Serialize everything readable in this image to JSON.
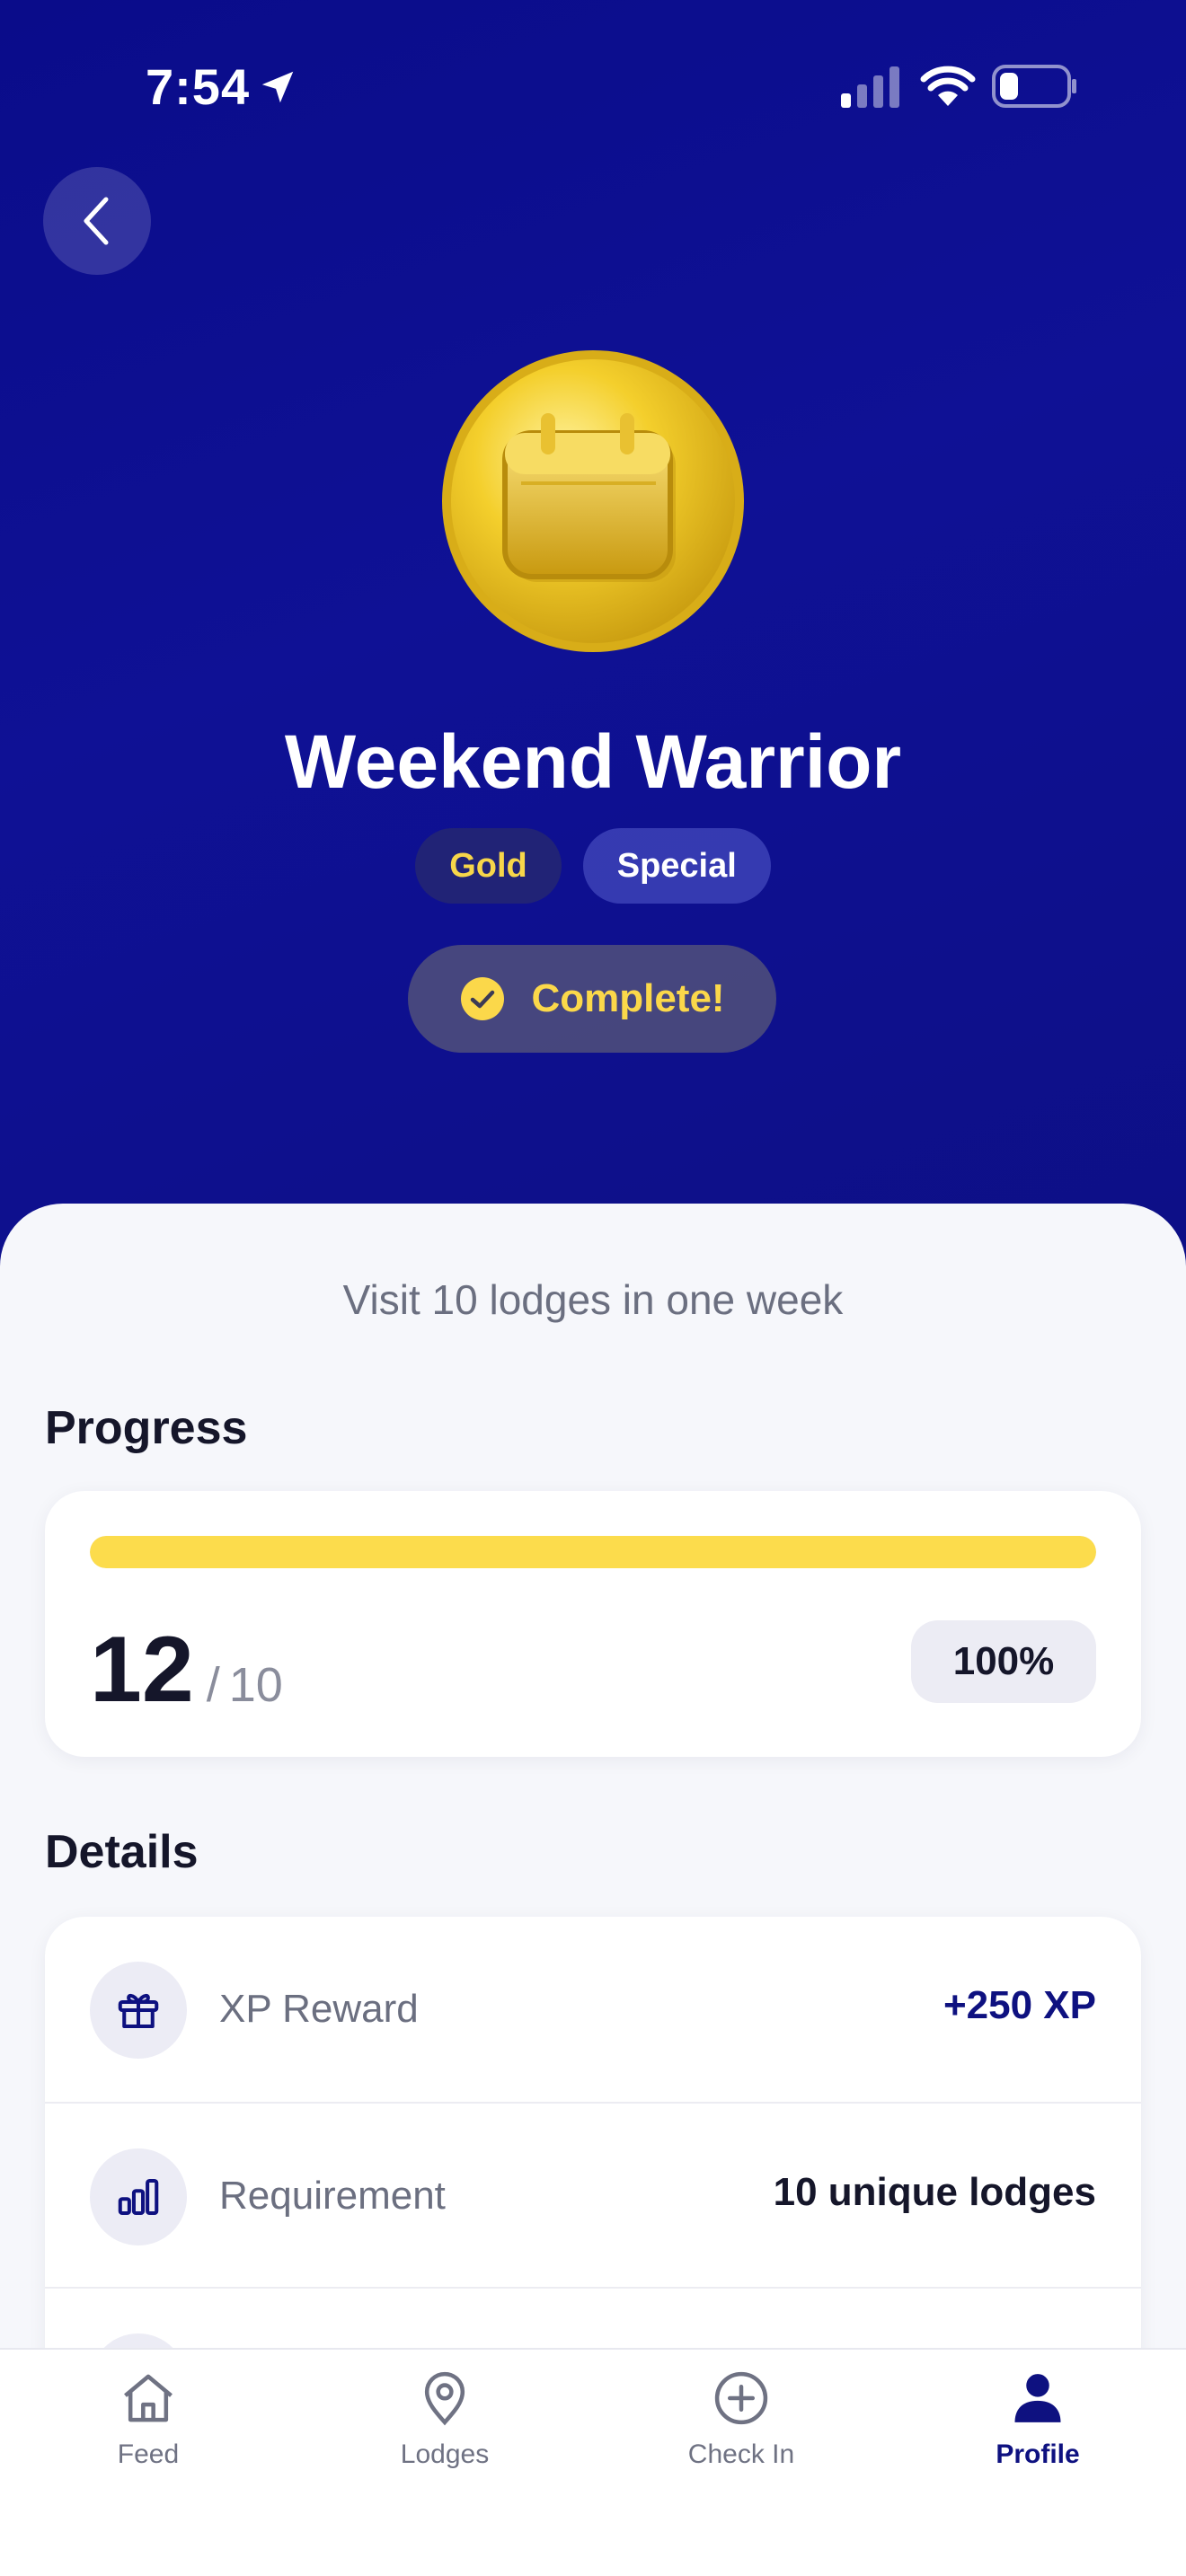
{
  "status_bar": {
    "time": "7:54"
  },
  "badge": {
    "title": "Weekend Warrior",
    "tags": [
      "Gold",
      "Special"
    ],
    "status": "Complete!",
    "description": "Visit 10 lodges in one week"
  },
  "progress": {
    "section_title": "Progress",
    "current": "12",
    "separator": "/",
    "total": "10",
    "percent_label": "100%",
    "fill_fraction": 1.0
  },
  "details": {
    "section_title": "Details",
    "rows": [
      {
        "label": "XP Reward",
        "value": "+250 XP",
        "icon": "gift-icon"
      },
      {
        "label": "Requirement",
        "value": "10 unique lodges",
        "icon": "bar-chart-icon"
      }
    ]
  },
  "tabbar": {
    "items": [
      {
        "label": "Feed",
        "icon": "home-icon"
      },
      {
        "label": "Lodges",
        "icon": "location-pin-icon"
      },
      {
        "label": "Check In",
        "icon": "plus-circle-icon"
      },
      {
        "label": "Profile",
        "icon": "person-icon",
        "active": true
      }
    ]
  },
  "colors": {
    "hero_background": "#0f1195",
    "accent_yellow": "#fcdc4c",
    "active_tab": "#0e1180"
  }
}
